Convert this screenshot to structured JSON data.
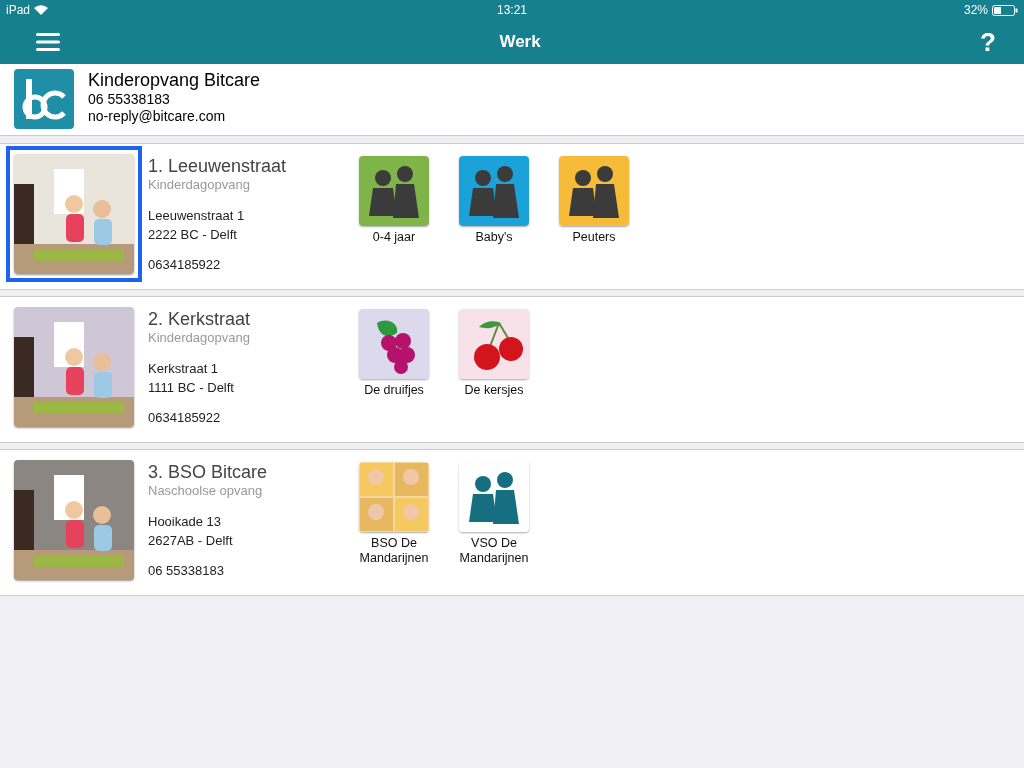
{
  "status_bar": {
    "device": "iPad",
    "time": "13:21",
    "battery": "32%"
  },
  "nav_bar": {
    "title": "Werk",
    "help": "?"
  },
  "organization": {
    "name": "Kinderopvang Bitcare",
    "phone": "06 55338183",
    "email": "no-reply@bitcare.com"
  },
  "locations": [
    {
      "name": "1. Leeuwenstraat",
      "type": "Kinderdagopvang",
      "street": "Leeuwenstraat 1",
      "city": "2222 BC - Delft",
      "phone": "0634185922",
      "selected": true,
      "groups": [
        {
          "label": "0-4 jaar",
          "kind": "silhouette",
          "color": "#7fb548"
        },
        {
          "label": "Baby's",
          "kind": "silhouette",
          "color": "#1ba3d9"
        },
        {
          "label": "Peuters",
          "kind": "silhouette",
          "color": "#f7bb3a"
        }
      ]
    },
    {
      "name": "2. Kerkstraat",
      "type": "Kinderdagopvang",
      "street": "Kerkstraat 1",
      "city": "1111 BC - Delft",
      "phone": "0634185922",
      "selected": false,
      "groups": [
        {
          "label": "De druifjes",
          "kind": "grapes",
          "color": "#dcd9ec"
        },
        {
          "label": "De kersjes",
          "kind": "cherries",
          "color": "#f8e2ea"
        }
      ]
    },
    {
      "name": "3. BSO Bitcare",
      "type": "Naschoolse opvang",
      "street": "Hooikade 13",
      "city": "2627AB - Delft",
      "phone": "06 55338183",
      "selected": false,
      "groups": [
        {
          "label": "BSO De Mandarijnen",
          "kind": "picture",
          "color": "#f3d9a0"
        },
        {
          "label": "VSO De Mandarijnen",
          "kind": "silhouette",
          "color": "#ffffff"
        }
      ]
    }
  ]
}
